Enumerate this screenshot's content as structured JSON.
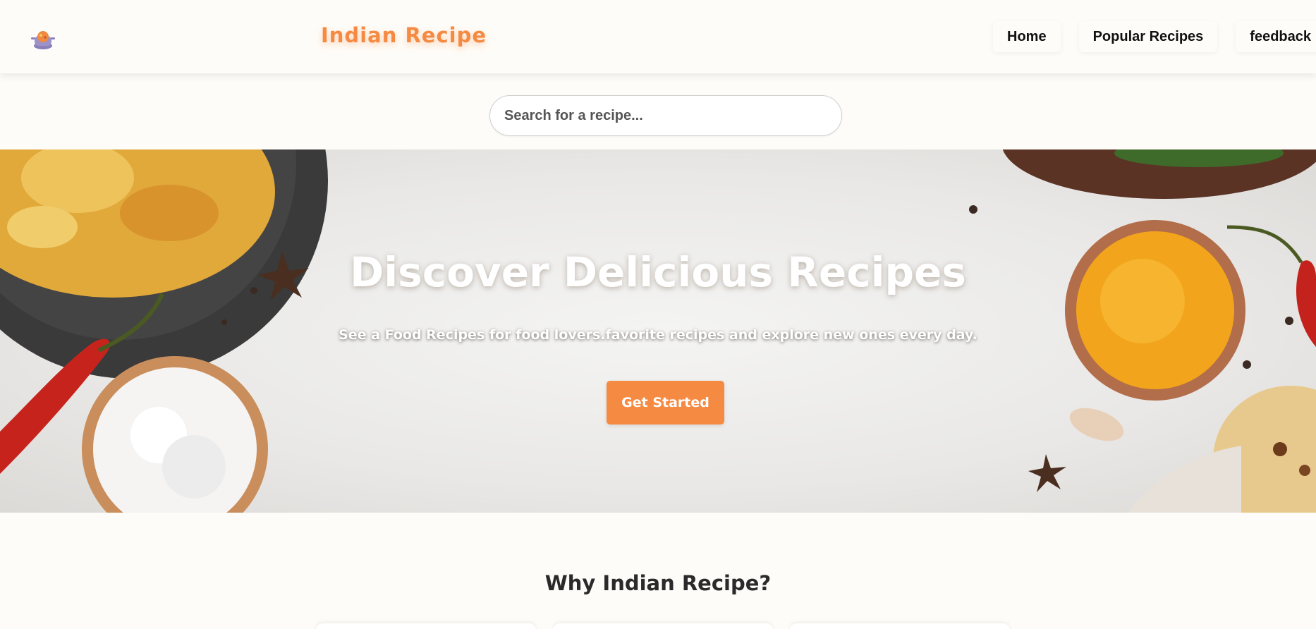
{
  "navbar": {
    "logo_icon": "cooking-pot-icon",
    "brand": "Indian Recipe",
    "links": [
      {
        "label": "Home"
      },
      {
        "label": "Popular Recipes"
      },
      {
        "label": "feedback"
      }
    ]
  },
  "search": {
    "placeholder": "Search for a recipe..."
  },
  "hero": {
    "title": "Discover Delicious Recipes",
    "subtitle": "See a Food Recipes for food lovers.favorite recipes and explore new ones every day.",
    "cta_label": "Get Started"
  },
  "why": {
    "title": "Why Indian Recipe?"
  },
  "colors": {
    "accent": "#f58a42",
    "background": "#fefcf8"
  }
}
